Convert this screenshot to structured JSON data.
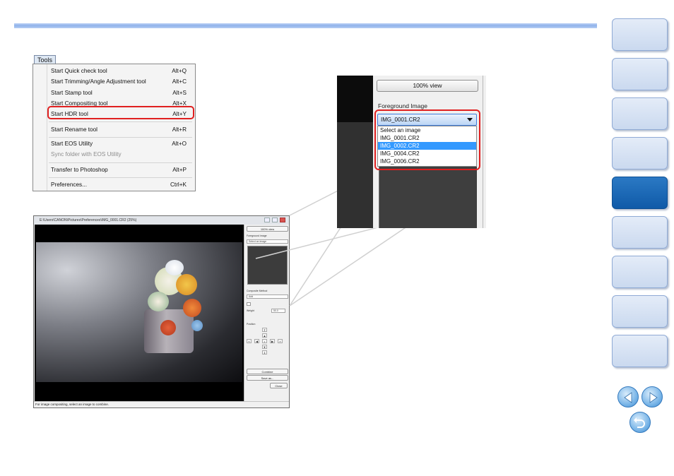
{
  "menu": {
    "title": "Tools",
    "items": [
      {
        "label": "Start Quick check tool",
        "shortcut": "Alt+Q",
        "enabled": true
      },
      {
        "label": "Start Trimming/Angle Adjustment tool",
        "shortcut": "Alt+C",
        "enabled": true
      },
      {
        "label": "Start Stamp tool",
        "shortcut": "Alt+S",
        "enabled": true
      },
      {
        "label": "Start Compositing tool",
        "shortcut": "Alt+X",
        "enabled": true,
        "highlighted": true
      },
      {
        "label": "Start HDR tool",
        "shortcut": "Alt+Y",
        "enabled": true
      },
      {
        "label": "Start Rename tool",
        "shortcut": "Alt+R",
        "enabled": true
      },
      {
        "label": "Start EOS Utility",
        "shortcut": "Alt+O",
        "enabled": true
      },
      {
        "label": "Sync folder with EOS Utility",
        "shortcut": "",
        "enabled": false
      },
      {
        "label": "Transfer to Photoshop",
        "shortcut": "Alt+P",
        "enabled": true
      },
      {
        "label": "Preferences...",
        "shortcut": "Ctrl+K",
        "enabled": true
      }
    ]
  },
  "compositing_window": {
    "title": "E:\\Users\\CANON\\Pictures\\Preferences\\IMG_0001.CR2 (25%)",
    "view_button": "100% view",
    "foreground_label": "Foreground image",
    "foreground_value": "Select an image",
    "composite_method_label": "Composite Method",
    "composite_method_value": "Add",
    "weight_label": "Weight",
    "weight_value": "50.0",
    "position_label": "Position",
    "combine_button": "Combine",
    "save_button": "Save as...",
    "close_button": "Close",
    "status": "For image compositing, select an image to combine."
  },
  "zoom": {
    "view_button": "100% view",
    "foreground_label": "Foreground Image",
    "selected_value": "IMG_0001.CR2",
    "options": [
      "Select an image",
      "IMG_0001.CR2",
      "IMG_0002.CR2",
      "IMG_0004.CR2",
      "IMG_0006.CR2"
    ],
    "highlighted_option": "IMG_0002.CR2"
  },
  "navigation": {
    "tabs": 9,
    "active_tab_index": 4,
    "icons": [
      "prev-page-icon",
      "next-page-icon",
      "return-icon"
    ]
  }
}
